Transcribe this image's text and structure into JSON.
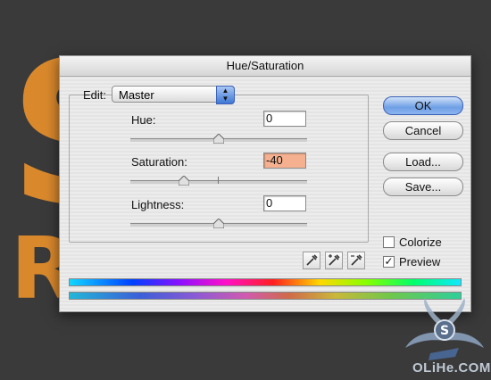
{
  "dialog": {
    "title": "Hue/Saturation",
    "edit": {
      "label": "Edit:",
      "selected": "Master"
    },
    "hue": {
      "label": "Hue:",
      "value": "0",
      "level": 0.5
    },
    "saturation": {
      "label": "Saturation:",
      "value": "-40",
      "level": 0.3
    },
    "lightness": {
      "label": "Lightness:",
      "value": "0",
      "level": 0.5
    },
    "buttons": {
      "ok": "OK",
      "cancel": "Cancel",
      "load": "Load...",
      "save": "Save..."
    },
    "colorize": {
      "label": "Colorize",
      "checked": false
    },
    "preview": {
      "label": "Preview",
      "checked": true
    },
    "icons": [
      "eyedropper-icon",
      "eyedropper-plus-icon",
      "eyedropper-minus-icon"
    ]
  },
  "background": {
    "letters": [
      "S",
      "R"
    ],
    "accent": "#d9882c"
  },
  "watermark": {
    "text": "OLiHe.COM"
  }
}
